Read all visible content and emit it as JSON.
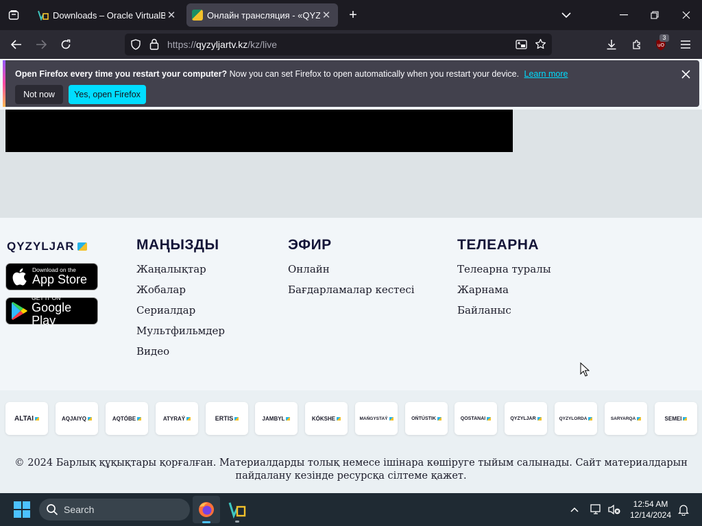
{
  "browser": {
    "tabs": [
      {
        "title": "Downloads – Oracle VirtualBox",
        "active": false
      },
      {
        "title": "Онлайн трансляция - «QYZYL",
        "active": true
      }
    ],
    "url": {
      "prefix": "https://",
      "host": "qyzyljartv.kz",
      "path": "/kz/live"
    },
    "extensions_badge": "3"
  },
  "notification": {
    "title": "Open Firefox every time you restart your computer?",
    "body": "Now you can set Firefox to open automatically when you restart your device.",
    "learn_more": "Learn more",
    "not_now": "Not now",
    "yes": "Yes, open Firefox"
  },
  "footer": {
    "logo": "QYZYLJAR",
    "appstore": {
      "small": "Download on the",
      "big": "App Store"
    },
    "googleplay": {
      "small": "GET IT ON",
      "big": "Google Play"
    },
    "columns": [
      {
        "heading": "МАҢЫЗДЫ",
        "links": [
          "Жаңалықтар",
          "Жобалар",
          "Сериалдар",
          "Мультфильмдер",
          "Видео"
        ]
      },
      {
        "heading": "ЭФИР",
        "links": [
          "Онлайн",
          "Бағдарламалар кестесі"
        ]
      },
      {
        "heading": "ТЕЛЕАРНА",
        "links": [
          "Телеарна туралы",
          "Жарнама",
          "Байланыс"
        ]
      }
    ],
    "partners": [
      "ALTAI",
      "AQJAIYQ",
      "AQTÓBE",
      "ATYRAÝ",
      "ERTIS",
      "JAMBYL",
      "KÓKSHE",
      "MAŃGYSTAÝ",
      "OŃTÚSTIK",
      "QOSTANAI",
      "QYZYLJAR",
      "QYZYLORDA",
      "SARYARQA",
      "SEMEI"
    ],
    "copyright_line1": "© 2024 Барлық құқықтары қорғалған. Материалдарды толық немесе ішінара көшіруге тыйым салынады. Сайт материалдарын",
    "copyright_line2": "пайдалану кезінде ресурсқа сілтеме қажет."
  },
  "taskbar": {
    "search_placeholder": "Search",
    "time": "12:54 AM",
    "date": "12/14/2024"
  },
  "colors": {
    "accent": "#00ddff",
    "tabbar": "#1c1b22",
    "footer_bg": "#f2f6f9",
    "taskbar": "#1f2a33"
  }
}
